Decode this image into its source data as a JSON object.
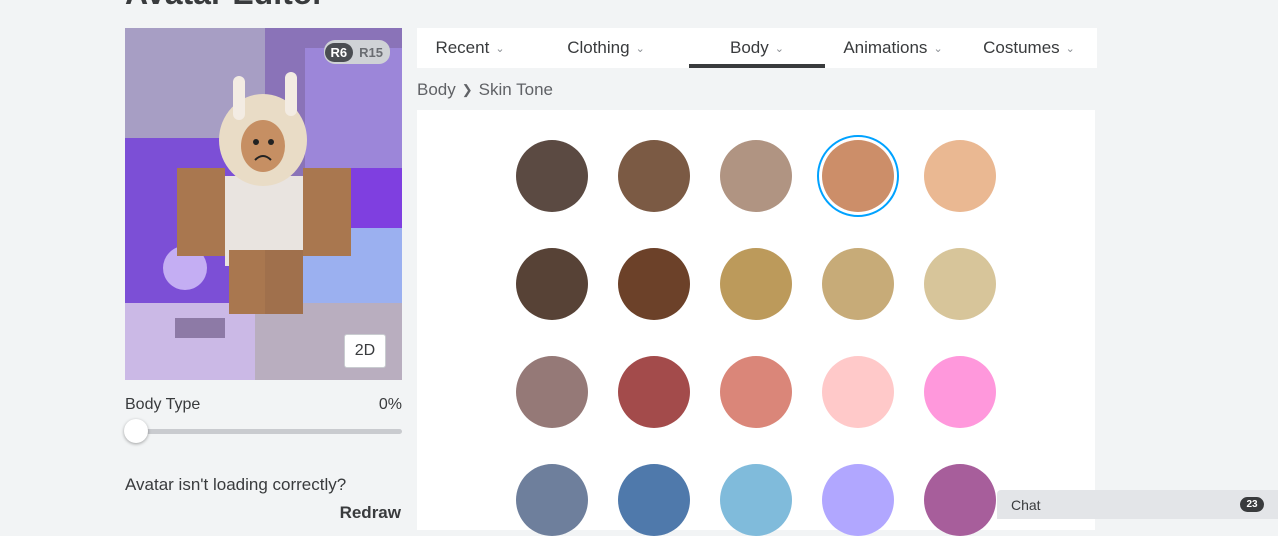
{
  "page": {
    "title": "Avatar Editor"
  },
  "avatar": {
    "rig_options": [
      "R6",
      "R15"
    ],
    "view_toggle": "2D",
    "body_type_label": "Body Type",
    "body_type_value": "0%",
    "body_type_fraction": 0,
    "help_text": "Avatar isn't loading correctly?",
    "redraw_label": "Redraw"
  },
  "tabs": [
    {
      "label": "Recent",
      "active": false
    },
    {
      "label": "Clothing",
      "active": false
    },
    {
      "label": "Body",
      "active": true
    },
    {
      "label": "Animations",
      "active": false
    },
    {
      "label": "Costumes",
      "active": false
    }
  ],
  "breadcrumb": {
    "parent": "Body",
    "current": "Skin Tone"
  },
  "skin_tones": [
    [
      "#5b4a42",
      "#7b5a44",
      "#b09482",
      "#cc8e69",
      "#eab892"
    ],
    [
      "#574236",
      "#6c4129",
      "#bc9a5b",
      "#c7ab78",
      "#d7c59a"
    ],
    [
      "#957977",
      "#a34b4b",
      "#da8679",
      "#ffc9c9",
      "#ff98dc"
    ],
    [
      "#6e7f9c",
      "#4f79ab",
      "#80bbdb",
      "#b1a7ff",
      "#a75e9b"
    ]
  ],
  "selected_tone": {
    "row": 0,
    "col": 3
  },
  "chat": {
    "label": "Chat",
    "unread": "23"
  }
}
